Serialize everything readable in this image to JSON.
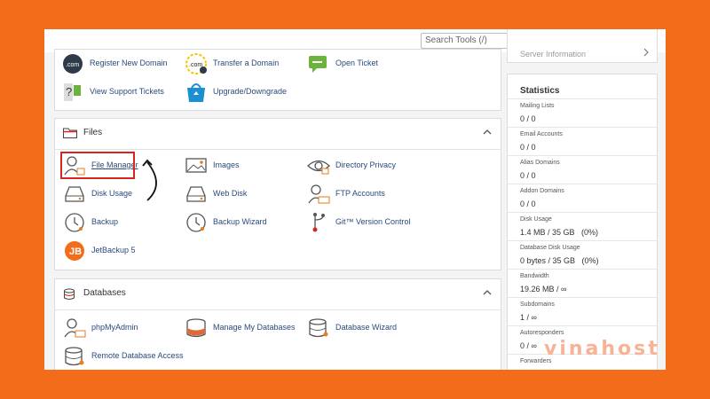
{
  "topbar": {
    "search_placeholder": "Search Tools (/)",
    "icons": [
      "search-icon",
      "bell-icon",
      "user-icon"
    ]
  },
  "top_section": {
    "items": [
      {
        "label": "Register New Domain",
        "icon": "dotcom-globe-icon"
      },
      {
        "label": "Transfer a Domain",
        "icon": "dotcom-transfer-icon"
      },
      {
        "label": "Open Ticket",
        "icon": "ticket-icon"
      },
      {
        "label": "View Support Tickets",
        "icon": "support-tickets-icon"
      },
      {
        "label": "Upgrade/Downgrade",
        "icon": "shopping-bag-icon"
      }
    ]
  },
  "files": {
    "title": "Files",
    "items": [
      {
        "label": "File Manager",
        "icon": "file-manager-icon"
      },
      {
        "label": "Images",
        "icon": "images-icon"
      },
      {
        "label": "Directory Privacy",
        "icon": "eye-icon"
      },
      {
        "label": "Disk Usage",
        "icon": "disk-usage-icon"
      },
      {
        "label": "Web Disk",
        "icon": "web-disk-icon"
      },
      {
        "label": "FTP Accounts",
        "icon": "ftp-accounts-icon"
      },
      {
        "label": "Backup",
        "icon": "backup-clock-icon"
      },
      {
        "label": "Backup Wizard",
        "icon": "backup-wizard-icon"
      },
      {
        "label": "Git™ Version Control",
        "icon": "git-icon"
      },
      {
        "label": "JetBackup 5",
        "icon": "jetbackup-icon"
      }
    ]
  },
  "databases": {
    "title": "Databases",
    "items": [
      {
        "label": "phpMyAdmin",
        "icon": "phpmyadmin-icon"
      },
      {
        "label": "Manage My Databases",
        "icon": "database-icon"
      },
      {
        "label": "Database Wizard",
        "icon": "database-wizard-icon"
      },
      {
        "label": "Remote Database Access",
        "icon": "remote-database-icon"
      }
    ]
  },
  "sidebar": {
    "server_info_label": "Server Information",
    "statistics_title": "Statistics",
    "stats": [
      {
        "key": "Mailing Lists",
        "value": "0 / 0"
      },
      {
        "key": "Email Accounts",
        "value": "0 / 0"
      },
      {
        "key": "Alias Domains",
        "value": "0 / 0"
      },
      {
        "key": "Addon Domains",
        "value": "0 / 0"
      },
      {
        "key": "Disk Usage",
        "value": "1.4 MB / 35 GB   (0%)"
      },
      {
        "key": "Database Disk Usage",
        "value": "0 bytes / 35 GB   (0%)"
      },
      {
        "key": "Bandwidth",
        "value": "19.26 MB / ∞"
      },
      {
        "key": "Subdomains",
        "value": "1 / ∞"
      },
      {
        "key": "Autoresponders",
        "value": "0 / ∞"
      },
      {
        "key": "Forwarders",
        "value": ""
      }
    ]
  },
  "watermark": {
    "text": "vinahost"
  },
  "colors": {
    "background": "#f26c1a",
    "highlight": "#d9261c",
    "link": "#2a4a7c"
  }
}
